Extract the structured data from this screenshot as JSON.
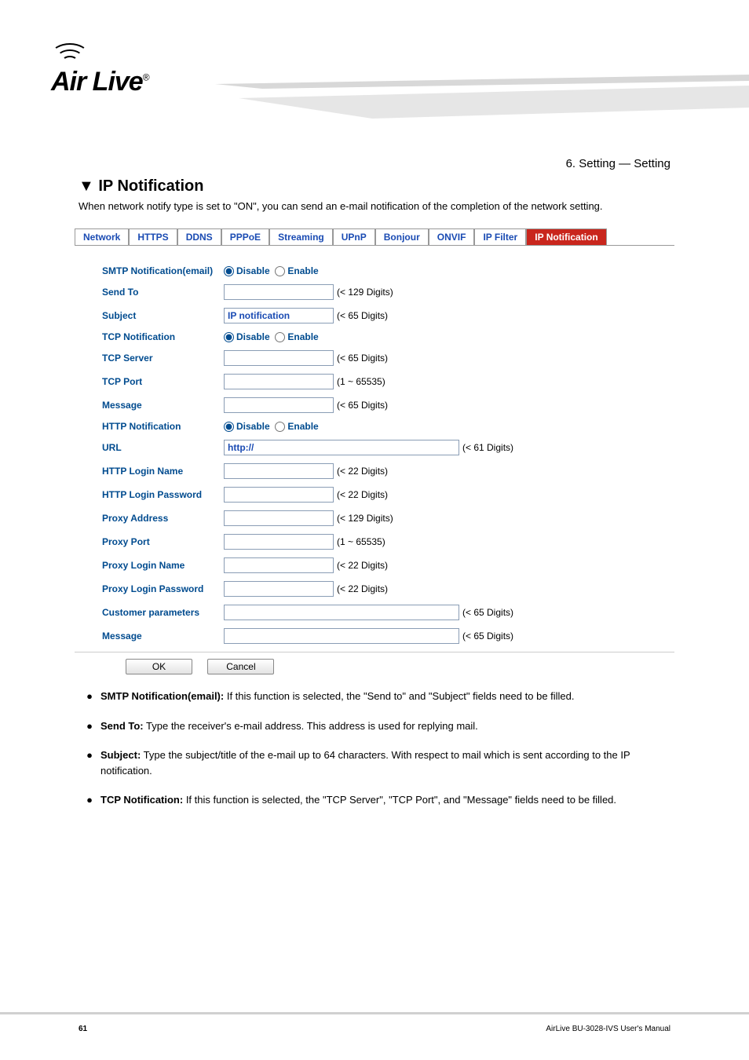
{
  "logo_text": "Air Live",
  "logo_tm": "®",
  "chapter_banner": "6. Setting — Setting",
  "section_title": "▼ IP Notification",
  "section_desc": "When network notify type is set to \"ON\", you can send an e-mail notification of the completion of the network setting.",
  "tabs": [
    "Network",
    "HTTPS",
    "DDNS",
    "PPPoE",
    "Streaming",
    "UPnP",
    "Bonjour",
    "ONVIF",
    "IP Filter",
    "IP Notification"
  ],
  "form": {
    "smtp_lbl": "SMTP Notification(email)",
    "disable": "Disable",
    "enable": "Enable",
    "sendto_lbl": "Send To",
    "sendto_hint": "(< 129 Digits)",
    "subject_lbl": "Subject",
    "subject_val": "IP notification",
    "subject_hint": "(< 65 Digits)",
    "tcpnotif_lbl": "TCP Notification",
    "tcpserver_lbl": "TCP Server",
    "tcpserver_hint": "(< 65 Digits)",
    "tcpport_lbl": "TCP Port",
    "tcpport_hint": "(1 ~ 65535)",
    "message_lbl": "Message",
    "message_hint": "(< 65 Digits)",
    "httpnotif_lbl": "HTTP Notification",
    "url_lbl": "URL",
    "url_val": "http://",
    "url_hint": "(< 61 Digits)",
    "httplogin_lbl": "HTTP Login Name",
    "httplogin_hint": "(< 22 Digits)",
    "httppass_lbl": "HTTP Login Password",
    "httppass_hint": "(< 22 Digits)",
    "proxyaddr_lbl": "Proxy Address",
    "proxyaddr_hint": "(< 129 Digits)",
    "proxyport_lbl": "Proxy Port",
    "proxyport_hint": "(1 ~ 65535)",
    "proxylogin_lbl": "Proxy Login Name",
    "proxylogin_hint": "(< 22 Digits)",
    "proxypass_lbl": "Proxy Login Password",
    "proxypass_hint": "(< 22 Digits)",
    "custparam_lbl": "Customer parameters",
    "custparam_hint": "(< 65 Digits)",
    "message2_lbl": "Message",
    "message2_hint": "(< 65 Digits)"
  },
  "btn_ok": "OK",
  "btn_cancel": "Cancel",
  "bullets": [
    {
      "title": "SMTP Notification(email):",
      "body": " If this function is selected, the \"Send to\" and \"Subject\" fields need to be filled."
    },
    {
      "title": "Send To:",
      "body": " Type the receiver's e-mail address. This address is used for replying mail."
    },
    {
      "title": "Subject:",
      "body": " Type the subject/title of the e-mail up to 64 characters. With respect to mail which is sent according to the IP notification."
    },
    {
      "title": "TCP Notification:",
      "body": " If this function is selected, the \"TCP Server\", \"TCP Port\", and \"Message\" fields need to be filled."
    }
  ],
  "footer_left": "AirLive BU-3028-IVS User's Manual",
  "footer_page": "61"
}
